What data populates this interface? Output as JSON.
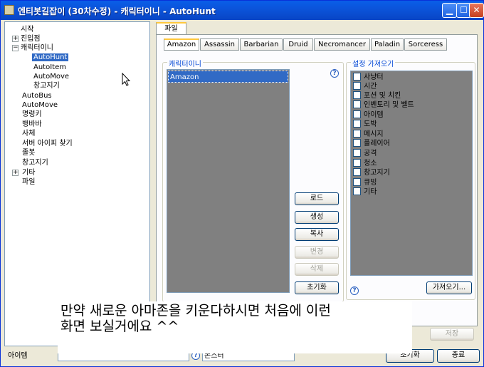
{
  "window": {
    "title": "엔티봇길잡이 (30차수정) - 캐릭터이니 - AutoHunt",
    "controls": [
      "minimize",
      "maximize",
      "close"
    ]
  },
  "tree": {
    "items": [
      {
        "label": "시작",
        "expander": ""
      },
      {
        "label": "진입점",
        "expander": "+"
      },
      {
        "label": "캐릭터이니",
        "expander": "−"
      },
      {
        "label": "AutoHunt",
        "expander": "",
        "selected": true
      },
      {
        "label": "AutoItem",
        "expander": ""
      },
      {
        "label": "AutoMove",
        "expander": ""
      },
      {
        "label": "창고지기",
        "expander": ""
      },
      {
        "label": "AutoBus",
        "expander": ""
      },
      {
        "label": "AutoMove",
        "expander": ""
      },
      {
        "label": "명령키",
        "expander": ""
      },
      {
        "label": "뱅바바",
        "expander": ""
      },
      {
        "label": "사체",
        "expander": ""
      },
      {
        "label": "서버 아이피 찾기",
        "expander": ""
      },
      {
        "label": "졸봇",
        "expander": ""
      },
      {
        "label": "창고지기",
        "expander": ""
      },
      {
        "label": "기타",
        "expander": "+"
      },
      {
        "label": "파일",
        "expander": ""
      }
    ]
  },
  "main_tab": {
    "label": "파일"
  },
  "class_tabs": [
    {
      "label": "Amazon",
      "active": true
    },
    {
      "label": "Assassin"
    },
    {
      "label": "Barbarian"
    },
    {
      "label": "Druid"
    },
    {
      "label": "Necromancer"
    },
    {
      "label": "Paladin"
    },
    {
      "label": "Sorceress"
    }
  ],
  "character_group": {
    "title": "캐릭터이니",
    "items": [
      "Amazon"
    ],
    "help": "?"
  },
  "buttons": {
    "load": "로드",
    "create": "생성",
    "copy": "복사",
    "change": "변경",
    "delete": "삭제",
    "reset": "초기화"
  },
  "settings_group": {
    "title": "설정 가져오기",
    "options": [
      "사냥터",
      "시간",
      "포션 및 치킨",
      "인벤토리 및 벨트",
      "아이템",
      "도박",
      "메시지",
      "플레이어",
      "공격",
      "청소",
      "창고지기",
      "큐빙",
      "기타"
    ],
    "help": "?",
    "import_label": "가져오기..."
  },
  "footer": {
    "item_label": "아이템",
    "help": "?",
    "field2_value": "몬스터",
    "save_label": "저장",
    "reset_label": "초기화",
    "close_label": "종료"
  },
  "overlay": {
    "text": "만약 새로운 아마존을 키운다하시면 처음에 이런\n화면 보실거에요 ^^"
  }
}
